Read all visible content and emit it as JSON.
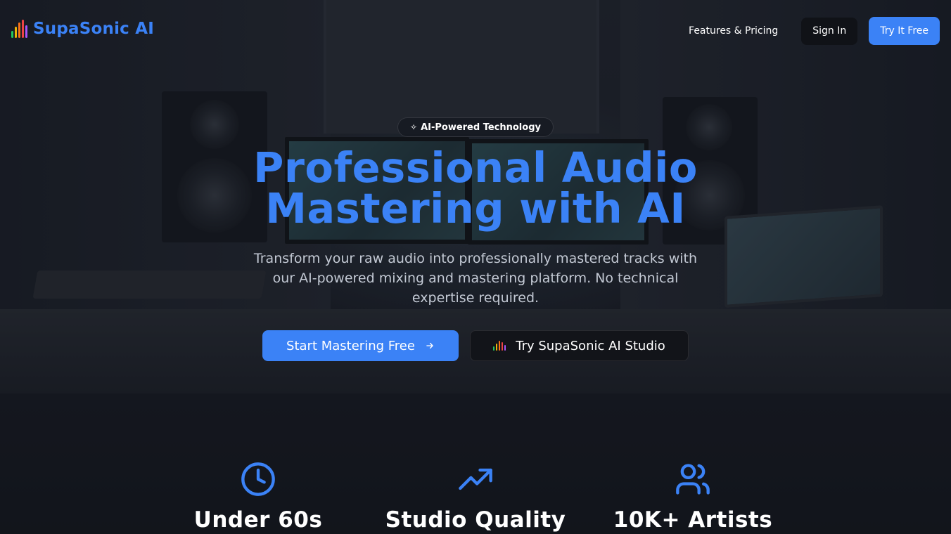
{
  "brand": {
    "name": "SupaSonic AI",
    "logo_colors": [
      "#22c55e",
      "#eab308",
      "#f97316",
      "#ef4444",
      "#a855f7"
    ]
  },
  "nav": {
    "features_pricing": "Features & Pricing",
    "sign_in": "Sign In",
    "try_free": "Try It Free"
  },
  "hero": {
    "badge": "AI-Powered Technology",
    "title_line1": "Professional Audio",
    "title_line2": "Mastering with AI",
    "subtitle": "Transform your raw audio into professionally mastered tracks with our AI-powered mixing and mastering platform. No technical expertise required.",
    "cta_primary": "Start Mastering Free",
    "cta_secondary": "Try SupaSonic AI Studio"
  },
  "stats": [
    {
      "icon": "clock-icon",
      "value": "Under 60s"
    },
    {
      "icon": "trending-up-icon",
      "value": "Studio Quality"
    },
    {
      "icon": "users-icon",
      "value": "10K+ Artists"
    }
  ],
  "colors": {
    "accent": "#3b82f6",
    "background": "#1a1e27",
    "subtitle": "#c3c9d4"
  }
}
